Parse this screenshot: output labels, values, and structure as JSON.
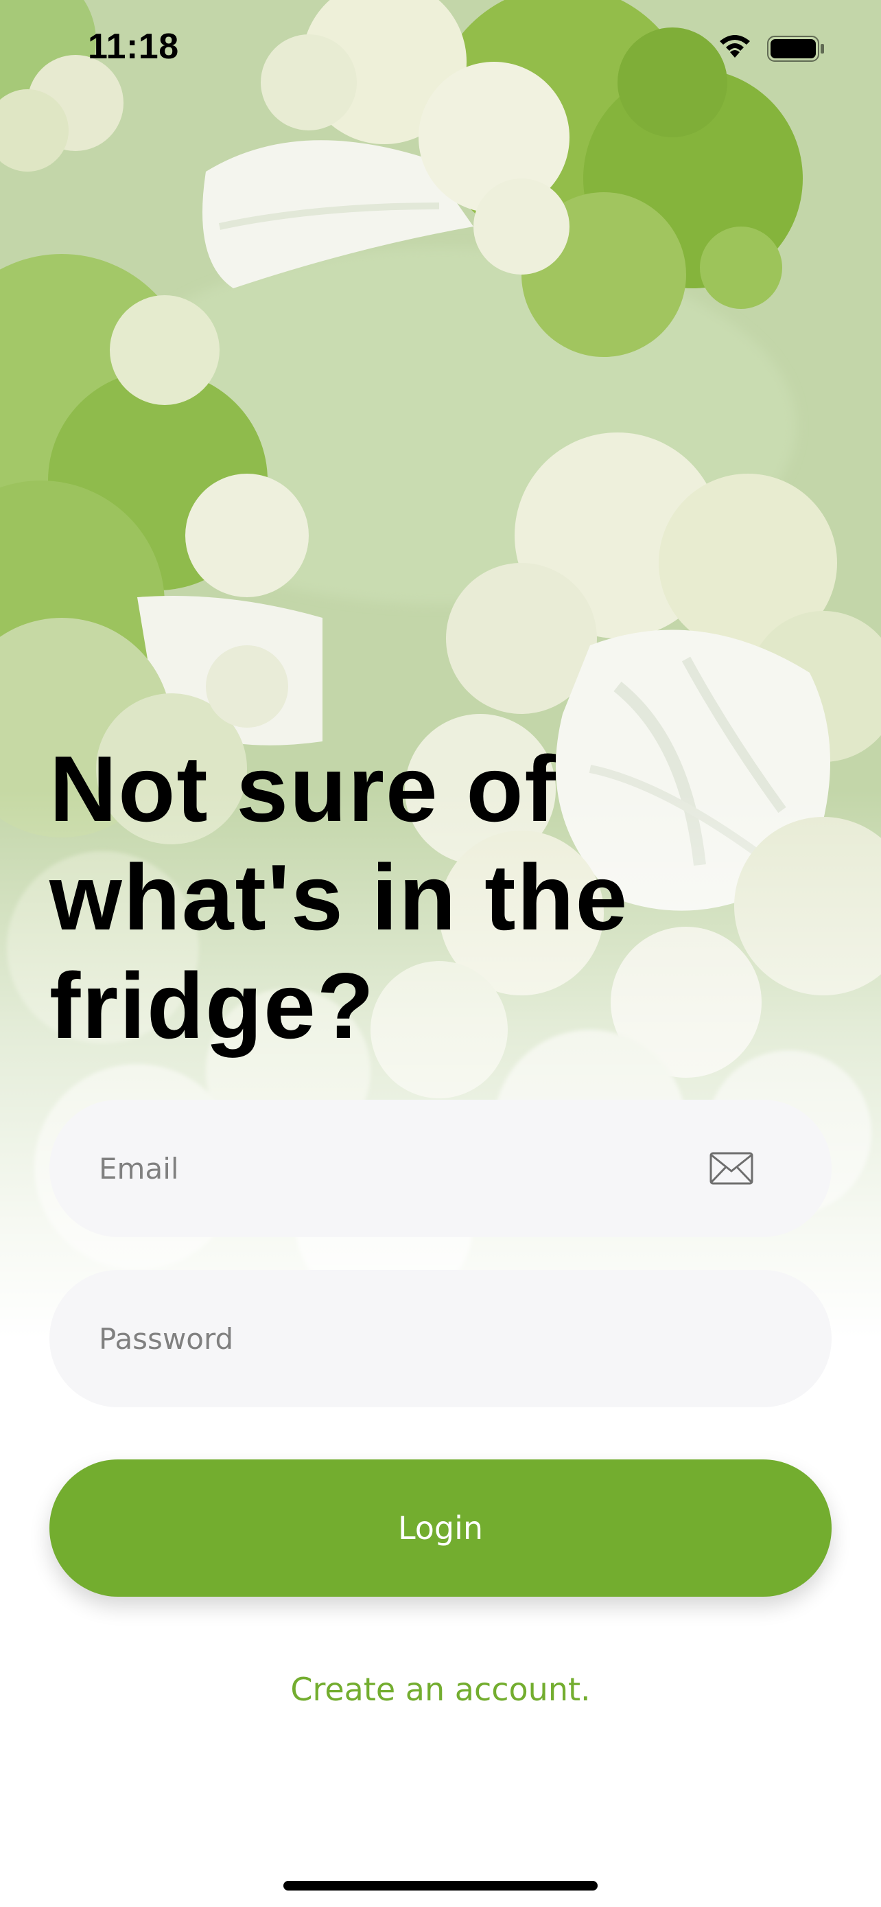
{
  "status_bar": {
    "time": "11:18"
  },
  "hero": {
    "headline": "Not sure of what's in the fridge?"
  },
  "form": {
    "email": {
      "placeholder": "Email",
      "value": ""
    },
    "password": {
      "placeholder": "Password",
      "value": ""
    },
    "login_label": "Login",
    "create_account_label": "Create an account."
  },
  "icons": {
    "wifi": "wifi-icon",
    "battery": "battery-icon",
    "email": "mail-icon"
  },
  "colors": {
    "accent": "#73ad2f",
    "field_background": "#f6f6f8",
    "hero_background": "#c3d6a9"
  }
}
